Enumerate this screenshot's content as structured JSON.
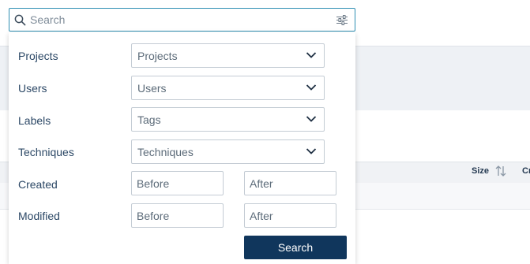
{
  "search": {
    "placeholder": "Search",
    "value": ""
  },
  "filters": {
    "projects": {
      "label": "Projects",
      "selected": "Projects"
    },
    "users": {
      "label": "Users",
      "selected": "Users"
    },
    "labels": {
      "label": "Labels",
      "selected": "Tags"
    },
    "techniques": {
      "label": "Techniques",
      "selected": "Techniques"
    },
    "created": {
      "label": "Created",
      "before_placeholder": "Before",
      "after_placeholder": "After"
    },
    "modified": {
      "label": "Modified",
      "before_placeholder": "Before",
      "after_placeholder": "After"
    },
    "submit_label": "Search"
  },
  "table": {
    "columns": [
      "Size",
      "Cr"
    ]
  },
  "icons": {
    "search": "search-icon",
    "filter": "sliders-icon",
    "chevron": "chevron-down-icon",
    "sort": "sort-icon"
  },
  "colors": {
    "accent_border": "#2f8fb3",
    "button": "#10365c",
    "label_text": "#2c4866"
  }
}
